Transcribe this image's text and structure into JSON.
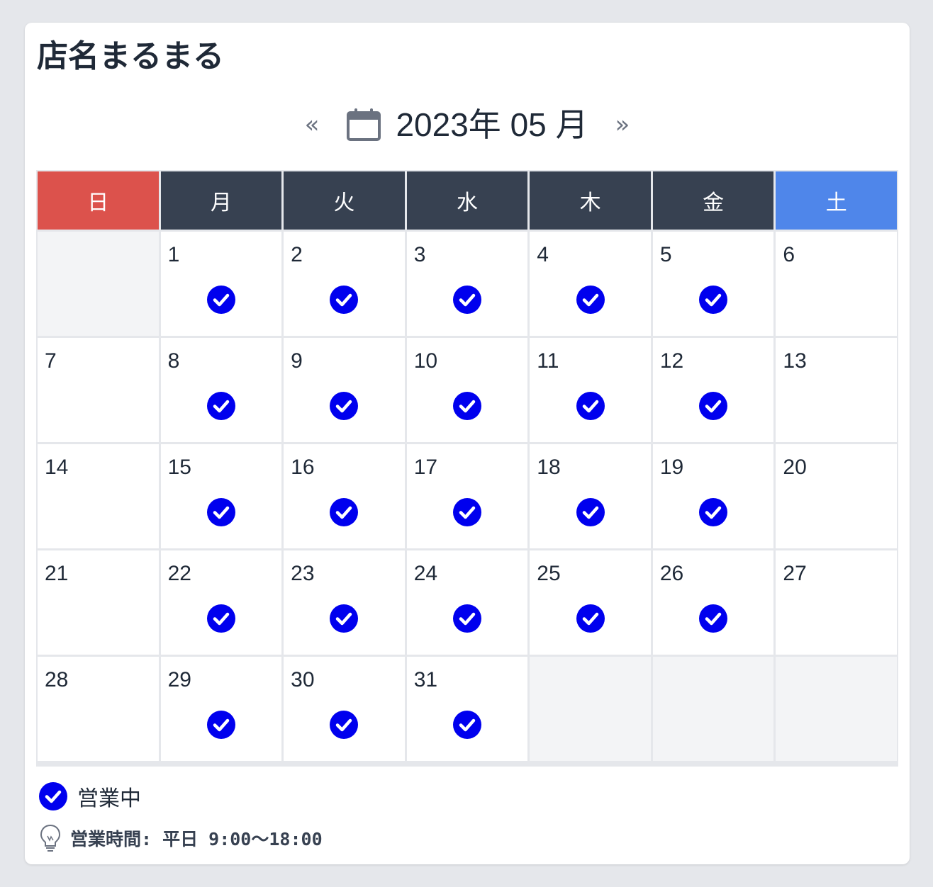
{
  "shop": {
    "name": "店名まるまる"
  },
  "nav": {
    "prev_label": "«",
    "next_label": "»",
    "month_label": "2023年 05 月",
    "icon": "calendar-icon"
  },
  "weekdays": [
    "日",
    "月",
    "火",
    "水",
    "木",
    "金",
    "土"
  ],
  "colors": {
    "sunday": "#dc524c",
    "saturday": "#4f86ea",
    "weekday": "#374151",
    "open_check": "#0000ee"
  },
  "weeks": [
    [
      null,
      1,
      2,
      3,
      4,
      5,
      6
    ],
    [
      7,
      8,
      9,
      10,
      11,
      12,
      13
    ],
    [
      14,
      15,
      16,
      17,
      18,
      19,
      20
    ],
    [
      21,
      22,
      23,
      24,
      25,
      26,
      27
    ],
    [
      28,
      29,
      30,
      31,
      null,
      null,
      null
    ]
  ],
  "open_days": [
    1,
    2,
    3,
    4,
    5,
    8,
    9,
    10,
    11,
    12,
    15,
    16,
    17,
    18,
    19,
    22,
    23,
    24,
    25,
    26,
    29,
    30,
    31
  ],
  "legend": {
    "open_label": "営業中",
    "icon": "check-circle-icon"
  },
  "hours": {
    "text": "営業時間: 平日 9:00〜18:00",
    "icon": "lightbulb-icon"
  }
}
